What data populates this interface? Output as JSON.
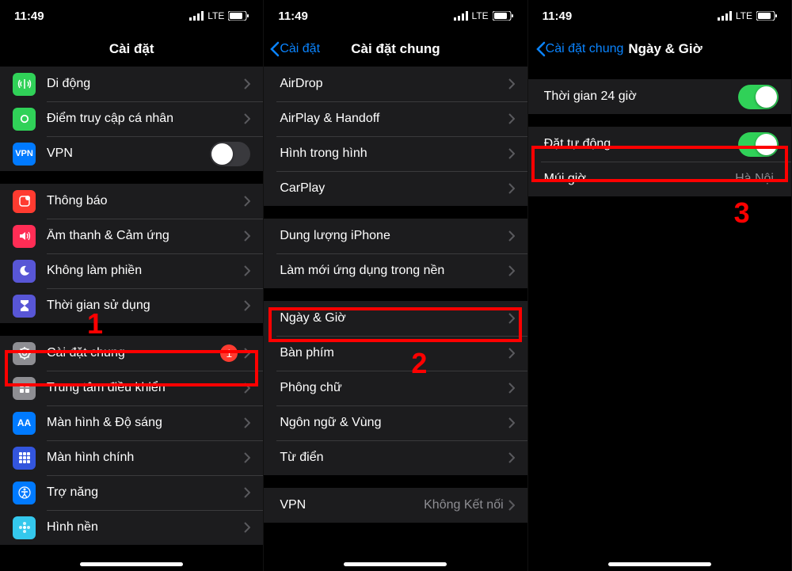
{
  "status": {
    "time": "11:49",
    "network": "LTE"
  },
  "annotations": {
    "n1": "1",
    "n2": "2",
    "n3": "3"
  },
  "p1": {
    "title": "Cài đặt",
    "rows": {
      "cellular": "Di động",
      "hotspot": "Điểm truy cập cá nhân",
      "vpn": "VPN",
      "notifications": "Thông báo",
      "sounds": "Âm thanh & Cảm ứng",
      "dnd": "Không làm phiền",
      "screentime": "Thời gian sử dụng",
      "general": "Cài đặt chung",
      "general_badge": "1",
      "control": "Trung tâm điều khiển",
      "display": "Màn hình & Độ sáng",
      "home": "Màn hình chính",
      "accessibility": "Trợ năng",
      "wallpaper": "Hình nền"
    }
  },
  "p2": {
    "back": "Cài đặt",
    "title": "Cài đặt chung",
    "rows": {
      "airdrop": "AirDrop",
      "airplay": "AirPlay & Handoff",
      "pip": "Hình trong hình",
      "carplay": "CarPlay",
      "storage": "Dung lượng iPhone",
      "refresh": "Làm mới ứng dụng trong nền",
      "datetime": "Ngày & Giờ",
      "keyboard": "Bàn phím",
      "fonts": "Phông chữ",
      "language": "Ngôn ngữ & Vùng",
      "dictionary": "Từ điển",
      "vpn": "VPN",
      "vpn_value": "Không Kết nối"
    }
  },
  "p3": {
    "back": "Cài đặt chung",
    "title": "Ngày & Giờ",
    "rows": {
      "h24": "Thời gian 24 giờ",
      "auto": "Đặt tự động",
      "timezone": "Múi giờ",
      "timezone_value": "Hà Nội"
    }
  },
  "colors": {
    "green": "#30d158",
    "blue": "#007aff",
    "red": "#ff3b30",
    "purple": "#5856d6",
    "gray": "#8e8e93",
    "orange": "#ff9500"
  }
}
